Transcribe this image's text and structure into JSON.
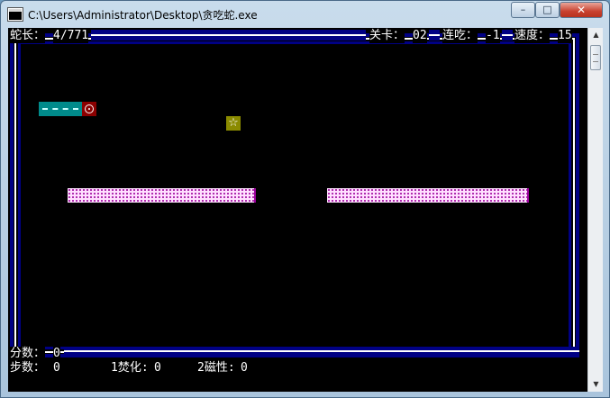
{
  "window": {
    "title": "C:\\Users\\Administrator\\Desktop\\贪吃蛇.exe",
    "minimize": "–",
    "maximize": "□",
    "close": "✕"
  },
  "hud_top": {
    "length_label": "蛇长：",
    "length_value": "4/771",
    "level_label": "关卡：",
    "level_value": "02",
    "combo_label": "连吃：",
    "combo_value": "-1",
    "speed_label": "速度：",
    "speed_value": "15"
  },
  "hud_bottom": {
    "score_label": "分数：",
    "score_value": "0",
    "steps_label": "步数：",
    "steps_value": "0",
    "item1_label": "1焚化:",
    "item1_value": "0",
    "item2_label": "2磁性:",
    "item2_value": "0"
  },
  "game": {
    "food_symbol": "☆",
    "colors": {
      "border": "#000084",
      "snake_body": "#008b8b",
      "snake_head": "#8b0000",
      "food": "#8b8b00",
      "wall": "#9b009b"
    }
  }
}
